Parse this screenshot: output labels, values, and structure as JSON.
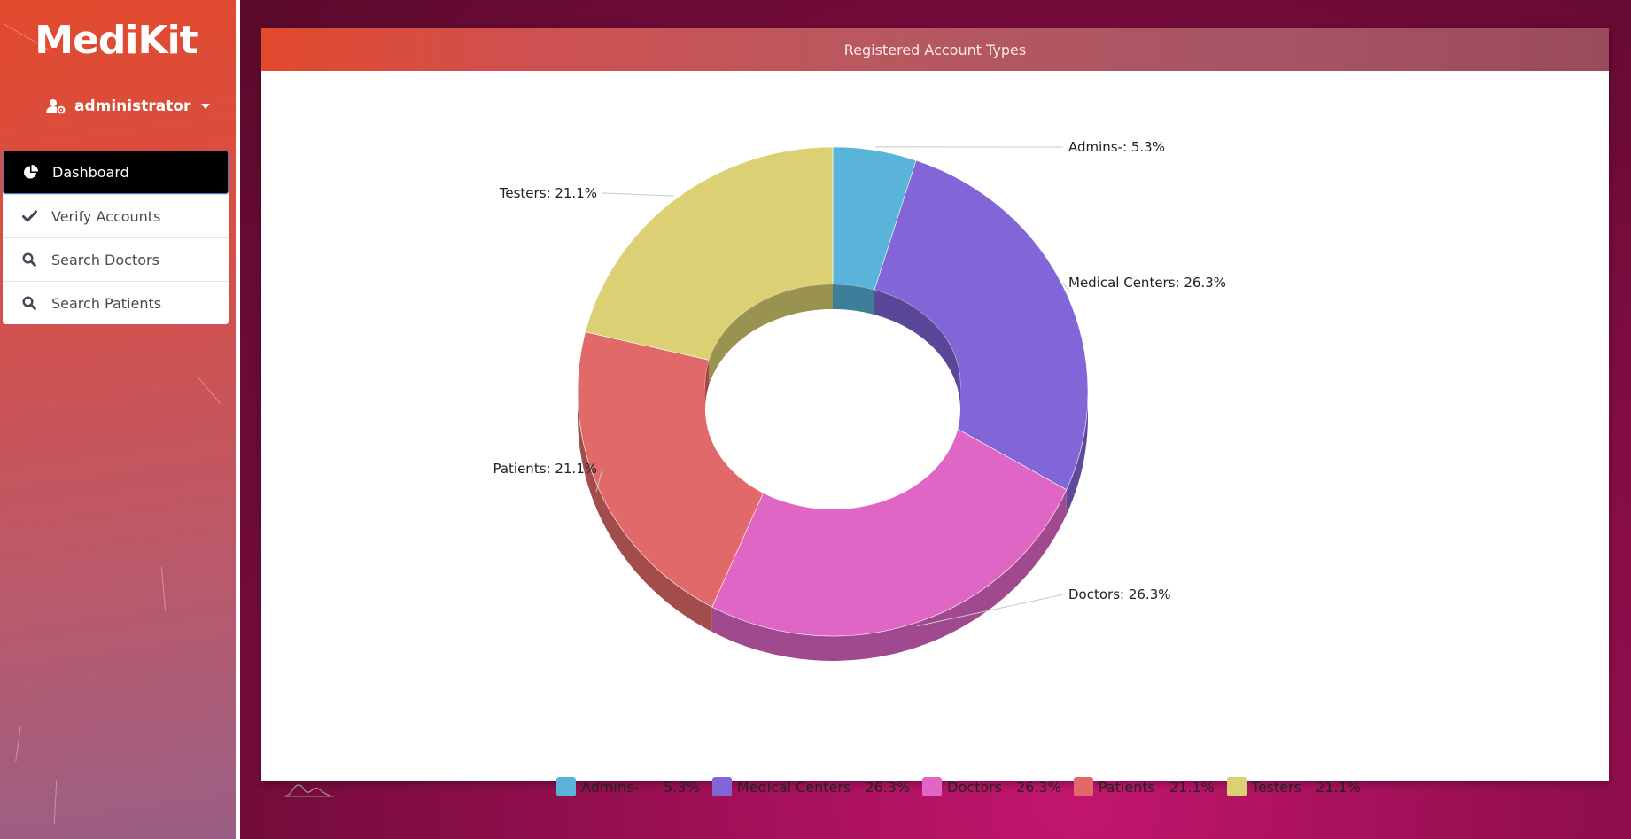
{
  "app": {
    "brand": "MediKit"
  },
  "user": {
    "name": "administrator",
    "icon": "user-cog-icon"
  },
  "nav": {
    "items": [
      {
        "label": "Dashboard",
        "icon": "pie-chart-icon",
        "active": true
      },
      {
        "label": "Verify Accounts",
        "icon": "check-icon",
        "active": false
      },
      {
        "label": "Search Doctors",
        "icon": "search-icon",
        "active": false
      },
      {
        "label": "Search Patients",
        "icon": "search-icon",
        "active": false
      }
    ]
  },
  "card": {
    "title": "Registered Account Types"
  },
  "colors": {
    "admins": "#5ab4d9",
    "medical_centers": "#8266d8",
    "doctors": "#e066c6",
    "patients": "#e2696a",
    "testers": "#dbd174"
  },
  "chart_data": {
    "type": "pie",
    "title": "Registered Account Types",
    "donut": true,
    "three_d": true,
    "series": [
      {
        "name": "Admins-",
        "value": 5.3,
        "percent_label": "5.3%",
        "color": "#5ab4d9"
      },
      {
        "name": "Medical Centers",
        "value": 26.3,
        "percent_label": "26.3%",
        "color": "#8266d8"
      },
      {
        "name": "Doctors",
        "value": 26.3,
        "percent_label": "26.3%",
        "color": "#e066c6"
      },
      {
        "name": "Patients",
        "value": 21.1,
        "percent_label": "21.1%",
        "color": "#e2696a"
      },
      {
        "name": "Testers",
        "value": 21.1,
        "percent_label": "21.1%",
        "color": "#dbd174"
      }
    ],
    "slice_labels": [
      "Admins-: 5.3%",
      "Medical Centers: 26.3%",
      "Doctors: 26.3%",
      "Patients: 21.1%",
      "Testers: 21.1%"
    ],
    "legend_position": "bottom"
  }
}
